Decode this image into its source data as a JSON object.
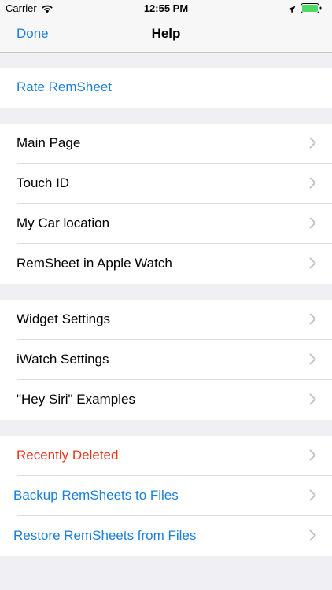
{
  "status_bar": {
    "carrier": "Carrier",
    "time": "12:55 PM",
    "icons": [
      "wifi-icon",
      "location-arrow-icon",
      "battery-icon"
    ]
  },
  "nav": {
    "done_label": "Done",
    "title": "Help"
  },
  "colors": {
    "accent": "#1a7fdb",
    "destructive": "#e8341c",
    "background": "#efeff4",
    "bar": "#f7f7f7"
  },
  "sections": [
    {
      "items": [
        {
          "label": "Rate RemSheet"
        }
      ]
    },
    {
      "items": [
        {
          "label": "Main Page"
        },
        {
          "label": "Touch ID"
        },
        {
          "label": "My Car location"
        },
        {
          "label": "RemSheet in Apple Watch"
        }
      ]
    },
    {
      "items": [
        {
          "label": "Widget Settings"
        },
        {
          "label": "iWatch Settings"
        },
        {
          "label": "\"Hey Siri\" Examples"
        }
      ]
    },
    {
      "items": [
        {
          "label": "Recently Deleted"
        },
        {
          "label": "Backup RemSheets to Files"
        },
        {
          "label": "Restore RemSheets from Files"
        }
      ]
    }
  ]
}
